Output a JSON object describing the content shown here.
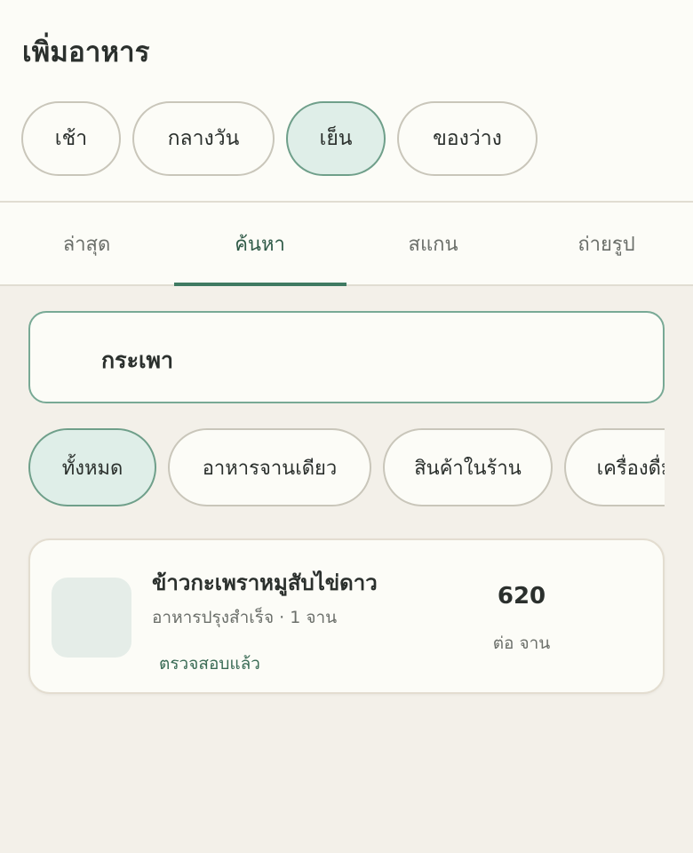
{
  "header": {
    "title": "เพิ่มอาหาร"
  },
  "meals": [
    {
      "label": "เช้า",
      "active": false
    },
    {
      "label": "กลางวัน",
      "active": false
    },
    {
      "label": "เย็น",
      "active": true
    },
    {
      "label": "ของว่าง",
      "active": false
    }
  ],
  "tabs": [
    {
      "label": "ล่าสุด",
      "active": false
    },
    {
      "label": "ค้นหา",
      "active": true
    },
    {
      "label": "สแกน",
      "active": false
    },
    {
      "label": "ถ่ายรูป",
      "active": false
    }
  ],
  "search": {
    "value": "กระเพา"
  },
  "filters": [
    {
      "label": "ทั้งหมด",
      "active": true
    },
    {
      "label": "อาหารจานเดียว",
      "active": false
    },
    {
      "label": "สินค้าในร้าน",
      "active": false
    },
    {
      "label": "เครื่องดื่ม",
      "active": false
    }
  ],
  "results": [
    {
      "name": "ข้าวกะเพราหมูสับไข่ดาว",
      "meta": "อาหารปรุงสำเร็จ · 1 จาน",
      "status": "ตรวจสอบแล้ว",
      "calories": "620",
      "unit": "ต่อ จาน"
    }
  ],
  "colors": {
    "accent": "#3f7a62",
    "chip_active_bg": "#dfeee8",
    "background": "#f3f0e9"
  }
}
